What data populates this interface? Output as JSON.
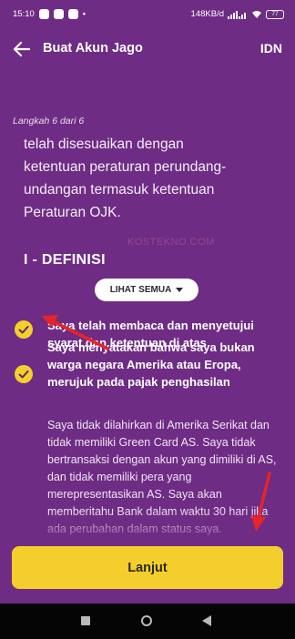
{
  "status_bar": {
    "time": "15:10",
    "network_speed": "148KB/d",
    "battery": "77"
  },
  "header": {
    "title": "Buat Akun Jago",
    "language": "IDN"
  },
  "step_label": "Langkah 6 dari 6",
  "body_lines": [
    "telah disesuaikan dengan",
    "ketentuan peraturan perundang-",
    "undangan termasuk ketentuan",
    "Peraturan OJK."
  ],
  "section_title": "I - DEFINISI",
  "see_all_label": "LIHAT SEMUA",
  "watermark": "KOSTEKNO.COM",
  "agreements": [
    {
      "text": "Saya telah membaca dan menyetujui syarat dan ketentuan di atas",
      "checked": true
    },
    {
      "text": "Saya menyatakan bahwa saya bukan warga negara Amerika atau Eropa, merujuk pada pajak penghasilan",
      "checked": true
    }
  ],
  "fatca_detail": "Saya tidak dilahirkan di Amerika Serikat dan tidak memiliki Green Card AS. Saya tidak bertransaksi dengan akun yang dimiliki di AS, dan tidak memiliki pera yang merepresentasikan AS. Saya akan memberitahu Bank dalam waktu 30 hari jika ada perubahan dalam status saya.",
  "next_button_label": "Lanjut",
  "colors": {
    "background": "#6e2c84",
    "accent": "#f4ce2c",
    "annotation_arrow": "#e8232a"
  }
}
